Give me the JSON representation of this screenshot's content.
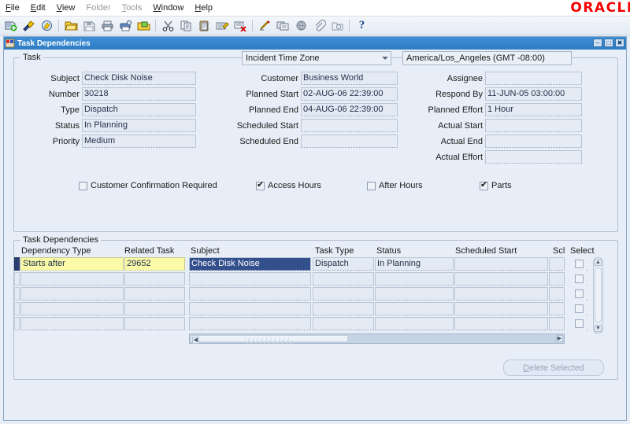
{
  "menubar": {
    "items": [
      {
        "label": "File",
        "enabled": true
      },
      {
        "label": "Edit",
        "enabled": true
      },
      {
        "label": "View",
        "enabled": true
      },
      {
        "label": "Folder",
        "enabled": false
      },
      {
        "label": "Tools",
        "enabled": false
      },
      {
        "label": "Window",
        "enabled": true
      },
      {
        "label": "Help",
        "enabled": true
      }
    ],
    "brand": "ORACLE"
  },
  "toolbar": {
    "icons": [
      "new-record-icon",
      "flashlight-find-icon",
      "show-navigator-icon",
      "separator",
      "open-folder-icon",
      "save-icon",
      "print-icon",
      "print-setup-icon",
      "export-icon",
      "separator",
      "cut-icon",
      "copy-icon",
      "paste-icon",
      "edit-record-icon",
      "delete-record-icon",
      "separator",
      "clear-record-icon",
      "duplicate-record-icon",
      "globe-icon",
      "attachment-icon",
      "folder-tools-icon",
      "separator",
      "help-icon"
    ]
  },
  "window": {
    "title": "Task Dependencies",
    "icon": "oracle-forms-icon",
    "controls": [
      {
        "name": "minimize-button",
        "glyph": "–"
      },
      {
        "name": "maximize-button",
        "glyph": "□"
      },
      {
        "name": "close-button",
        "glyph": "✖"
      }
    ]
  },
  "task_section": {
    "legend": "Task",
    "time_zone_selector": {
      "label": "Incident Time Zone",
      "value": "America/Los_Angeles (GMT -08:00)"
    },
    "left_fields": [
      {
        "label": "Subject",
        "value": "Check Disk Noise"
      },
      {
        "label": "Number",
        "value": "30218"
      },
      {
        "label": "Type",
        "value": "Dispatch"
      },
      {
        "label": "Status",
        "value": "In Planning"
      },
      {
        "label": "Priority",
        "value": "Medium"
      }
    ],
    "mid_fields": [
      {
        "label": "Customer",
        "value": "Business World"
      },
      {
        "label": "Planned Start",
        "value": "02-AUG-06 22:39:00"
      },
      {
        "label": "Planned End",
        "value": "04-AUG-06 22:39:00"
      },
      {
        "label": "Scheduled Start",
        "value": ""
      },
      {
        "label": "Scheduled End",
        "value": ""
      }
    ],
    "right_fields": [
      {
        "label": "Assignee",
        "value": ""
      },
      {
        "label": "Respond By",
        "value": "11-JUN-05 03:00:00"
      },
      {
        "label": "Planned Effort",
        "value": "1 Hour"
      },
      {
        "label": "Actual Start",
        "value": ""
      },
      {
        "label": "Actual End",
        "value": ""
      },
      {
        "label": "Actual Effort",
        "value": ""
      }
    ],
    "checkboxes": [
      {
        "label": "Customer Confirmation Required",
        "checked": false
      },
      {
        "label": "Access Hours",
        "checked": true
      },
      {
        "label": "After Hours",
        "checked": false
      },
      {
        "label": "Parts",
        "checked": true
      }
    ]
  },
  "dependencies_section": {
    "legend": "Task Dependencies",
    "columns": [
      "Dependency Type",
      "Related Task",
      "Subject",
      "Task Type",
      "Status",
      "Scheduled Start",
      "Scl",
      "Select"
    ],
    "rows": [
      {
        "dependency_type": "Starts after",
        "related_task": "29652",
        "subject": "Check Disk Noise",
        "task_type": "Dispatch",
        "status": "In Planning",
        "scheduled_start": "",
        "scl": "",
        "selected": false,
        "current": true
      },
      {
        "dependency_type": "",
        "related_task": "",
        "subject": "",
        "task_type": "",
        "status": "",
        "scheduled_start": "",
        "scl": "",
        "selected": false,
        "current": false
      },
      {
        "dependency_type": "",
        "related_task": "",
        "subject": "",
        "task_type": "",
        "status": "",
        "scheduled_start": "",
        "scl": "",
        "selected": false,
        "current": false
      },
      {
        "dependency_type": "",
        "related_task": "",
        "subject": "",
        "task_type": "",
        "status": "",
        "scheduled_start": "",
        "scl": "",
        "selected": false,
        "current": false
      },
      {
        "dependency_type": "",
        "related_task": "",
        "subject": "",
        "task_type": "",
        "status": "",
        "scheduled_start": "",
        "scl": "",
        "selected": false,
        "current": false
      }
    ],
    "delete_button": "Delete Selected"
  },
  "colors": {
    "window_bg": "#e8eef7",
    "titlebar": "#3f8fd6",
    "brand_red": "#f00000",
    "current_record": "#fafaa8",
    "selected_text_bg": "#33508c"
  }
}
